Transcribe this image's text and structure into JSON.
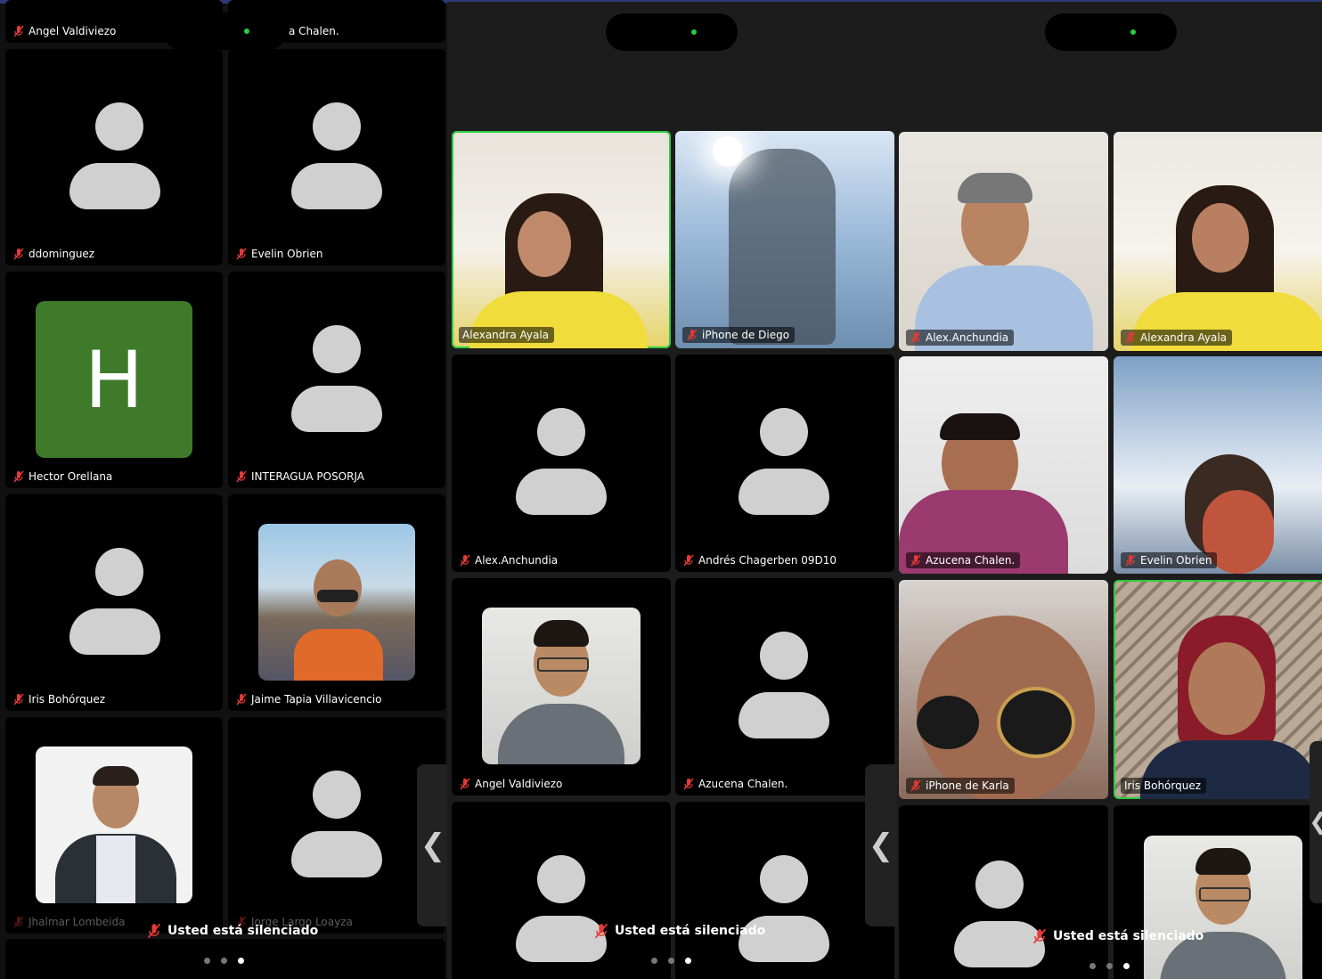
{
  "panel1": {
    "header_names": [
      "Angel Valdiviezo",
      "a Chalen."
    ],
    "tiles": [
      {
        "name": "ddominguez",
        "kind": "avatar"
      },
      {
        "name": "Evelin Obrien",
        "kind": "avatar"
      },
      {
        "name": "Hector Orellana",
        "kind": "initial",
        "initial": "H"
      },
      {
        "name": "INTERAGUA POSORJA",
        "kind": "avatar"
      },
      {
        "name": "Iris Bohórquez",
        "kind": "avatar"
      },
      {
        "name": "Jaime Tapia Villavicencio",
        "kind": "photo"
      },
      {
        "name": "Jhalmar Lombeida",
        "kind": "photo"
      },
      {
        "name": "Jorge Largo Loayza",
        "kind": "avatar"
      }
    ],
    "muted_text": "Usted está silenciado",
    "page_dots": 3,
    "active_dot": 3
  },
  "panel2": {
    "tiles": [
      {
        "name": "Alexandra Ayala",
        "kind": "video"
      },
      {
        "name": "iPhone de Diego",
        "kind": "video"
      },
      {
        "name": "Alex.Anchundia",
        "kind": "avatar"
      },
      {
        "name": "Andrés Chagerben 09D10",
        "kind": "avatar"
      },
      {
        "name": "Angel Valdiviezo",
        "kind": "photo"
      },
      {
        "name": "Azucena Chalen.",
        "kind": "avatar"
      }
    ],
    "muted_text": "Usted está silenciado",
    "page_dots": 3,
    "active_dot": 3
  },
  "panel3": {
    "tiles": [
      {
        "name": "Alex.Anchundia",
        "kind": "video"
      },
      {
        "name": "Alexandra Ayala",
        "kind": "video"
      },
      {
        "name": "Azucena Chalen.",
        "kind": "video"
      },
      {
        "name": "Evelin Obrien",
        "kind": "video"
      },
      {
        "name": "iPhone de Karla",
        "kind": "video"
      },
      {
        "name": "Iris Bohórquez",
        "kind": "video"
      }
    ],
    "muted_text": "Usted está silenciado",
    "page_dots": 3,
    "active_dot": 3
  },
  "colors": {
    "active_border": "#2ecc40",
    "mic_muted": "#e53935",
    "initial_bg": "#3e7a2a",
    "top_bar": "#2e3a73"
  },
  "icons": {
    "mic": "mic-muted-icon",
    "scroll": "chevron-left-icon",
    "avatar": "person-icon"
  }
}
